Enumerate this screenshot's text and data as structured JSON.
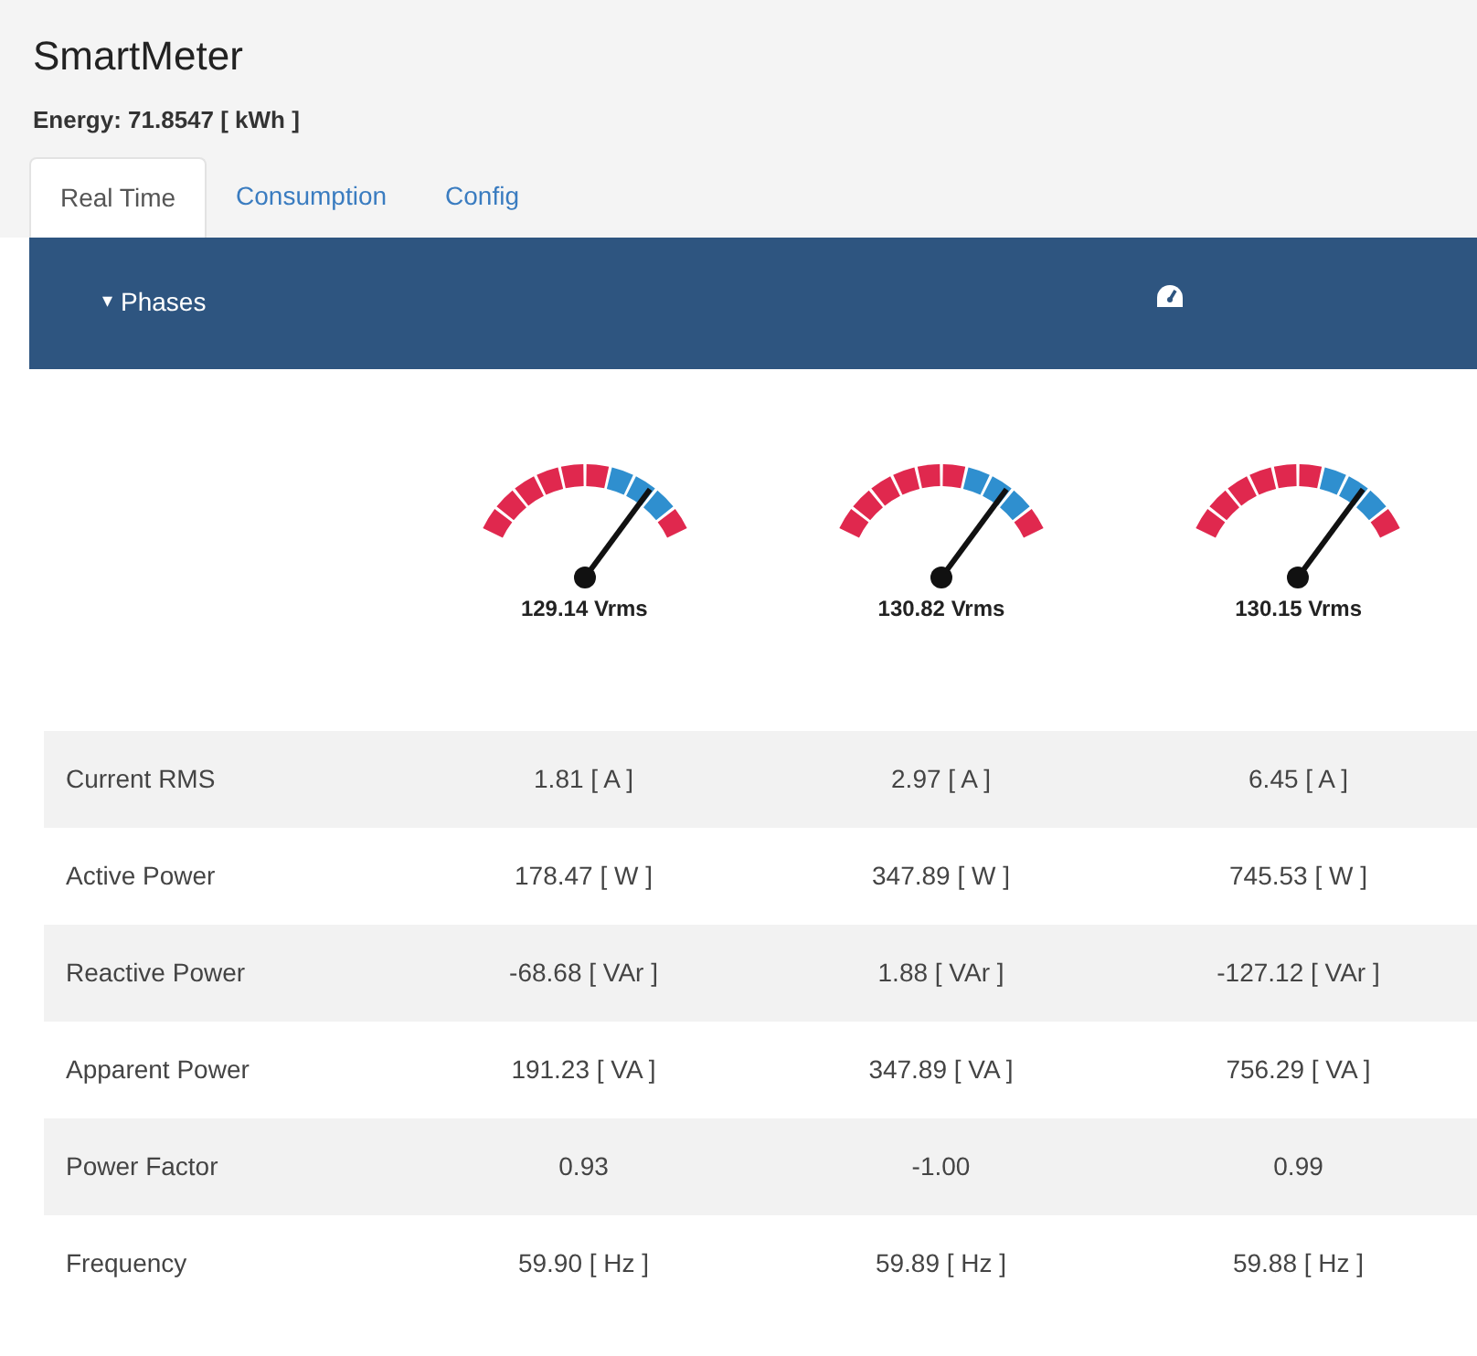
{
  "app": {
    "title": "SmartMeter",
    "energy": "Energy: 71.8547 [ kWh ]"
  },
  "tabs": [
    {
      "label": "Real Time",
      "selected": true
    },
    {
      "label": "Consumption",
      "selected": false
    },
    {
      "label": "Config",
      "selected": false
    }
  ],
  "panel": {
    "title": "Phases",
    "caret": "▾",
    "expanded": true
  },
  "gauges": [
    {
      "reading": "129.14 Vrms"
    },
    {
      "reading": "130.82 Vrms"
    },
    {
      "reading": "130.15 Vrms"
    }
  ],
  "table": {
    "rows": [
      {
        "label": "Current RMS",
        "values": [
          "1.81 [ A ]",
          "2.97 [ A ]",
          "6.45 [ A ]"
        ]
      },
      {
        "label": "Active Power",
        "values": [
          "178.47 [ W ]",
          "347.89 [ W ]",
          "745.53 [ W ]"
        ]
      },
      {
        "label": "Reactive Power",
        "values": [
          "-68.68 [ VAr ]",
          "1.88 [ VAr ]",
          "-127.12 [ VAr ]"
        ]
      },
      {
        "label": "Apparent Power",
        "values": [
          "191.23 [ VA ]",
          "347.89 [ VA ]",
          "756.29 [ VA ]"
        ]
      },
      {
        "label": "Power Factor",
        "values": [
          "0.93",
          "-1.00",
          "0.99"
        ]
      },
      {
        "label": "Frequency",
        "values": [
          "59.90 [ Hz ]",
          "59.89 [ Hz ]",
          "59.88 [ Hz ]"
        ]
      }
    ]
  }
}
